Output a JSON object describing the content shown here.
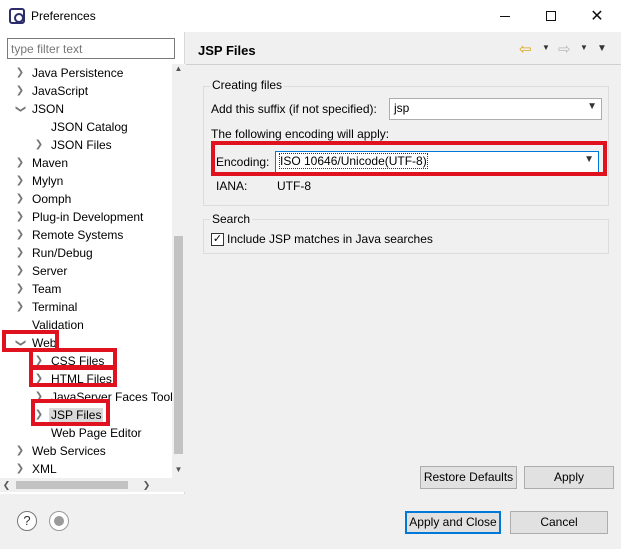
{
  "window": {
    "title": "Preferences"
  },
  "filter": {
    "placeholder": "type filter text",
    "value": ""
  },
  "tree": [
    {
      "label": "Java Persistence",
      "expanded": false
    },
    {
      "label": "JavaScript",
      "expanded": false
    },
    {
      "label": "JSON",
      "expanded": true
    },
    {
      "label": "JSON Catalog"
    },
    {
      "label": "JSON Files",
      "expanded": false
    },
    {
      "label": "Maven",
      "expanded": false
    },
    {
      "label": "Mylyn",
      "expanded": false
    },
    {
      "label": "Oomph",
      "expanded": false
    },
    {
      "label": "Plug-in Development",
      "expanded": false
    },
    {
      "label": "Remote Systems",
      "expanded": false
    },
    {
      "label": "Run/Debug",
      "expanded": false
    },
    {
      "label": "Server",
      "expanded": false
    },
    {
      "label": "Team",
      "expanded": false
    },
    {
      "label": "Terminal",
      "expanded": false
    },
    {
      "label": "Validation"
    },
    {
      "label": "Web",
      "expanded": true
    },
    {
      "label": "CSS Files",
      "expanded": false
    },
    {
      "label": "HTML Files",
      "expanded": false
    },
    {
      "label": "JavaServer Faces Tools",
      "expanded": false
    },
    {
      "label": "JSP Files",
      "expanded": false,
      "selected": true
    },
    {
      "label": "Web Page Editor"
    },
    {
      "label": "Web Services",
      "expanded": false
    },
    {
      "label": "XML",
      "expanded": false
    }
  ],
  "page": {
    "title": "JSP Files",
    "creating_group": {
      "title": "Creating files",
      "suffix_label": "Add this suffix (if not specified):",
      "suffix_value": "jsp",
      "encoding_note": "The following encoding will apply:",
      "encoding_label": "Encoding:",
      "encoding_value": "ISO 10646/Unicode(UTF-8)",
      "iana_label": "IANA:",
      "iana_value": "UTF-8"
    },
    "search_group": {
      "title": "Search",
      "include_label": "Include JSP matches in Java searches",
      "include_checked": true
    },
    "restore_defaults": "Restore Defaults",
    "apply": "Apply"
  },
  "footer": {
    "apply_and_close": "Apply and Close",
    "cancel": "Cancel"
  },
  "highlight_color": "#e0121f"
}
